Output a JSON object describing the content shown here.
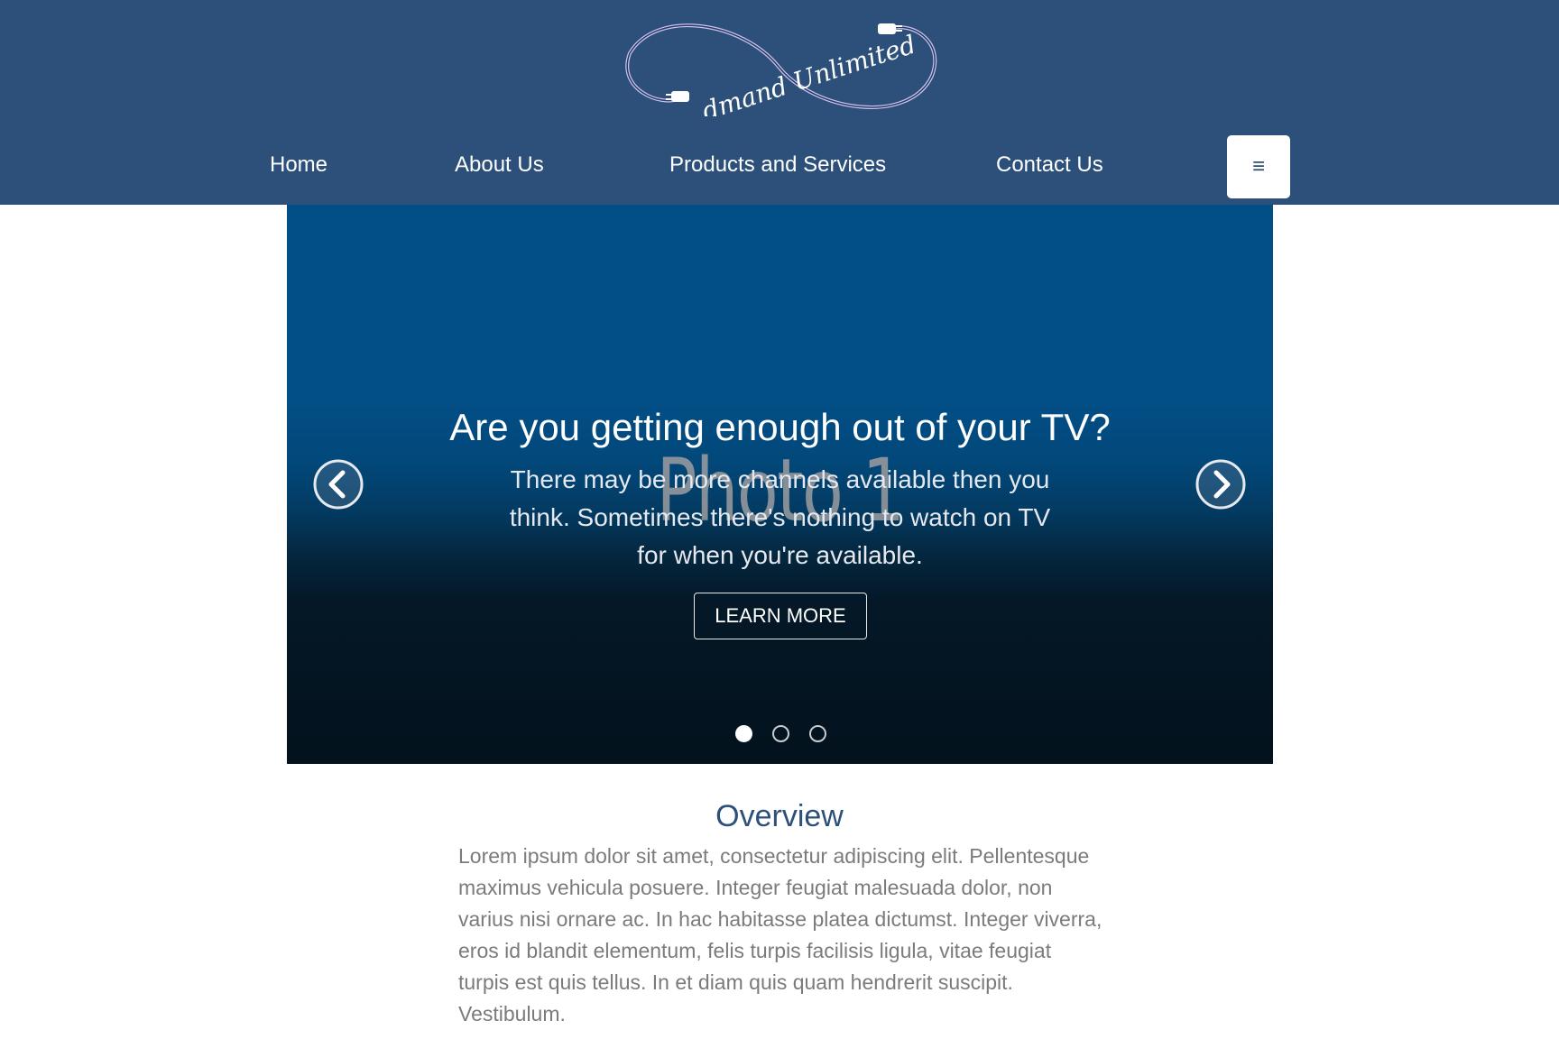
{
  "brand": {
    "logo_text": "dmand Unlimited",
    "colors": {
      "header_bg": "#2c5079",
      "hero_top": "#024f87",
      "hero_bottom": "#03121d",
      "heading": "#2c5079",
      "body_text": "#7b7b7b"
    }
  },
  "nav": {
    "items": [
      {
        "label": "Home"
      },
      {
        "label": "About Us"
      },
      {
        "label": "Products and Services"
      },
      {
        "label": "Contact Us"
      }
    ],
    "menu_icon": "hamburger-icon",
    "menu_glyph": "≡"
  },
  "hero": {
    "watermark": "Photo 1",
    "title": "Are you getting enough out of your TV?",
    "text": "There may be more channels available then you think. Sometimes there's nothing to watch on TV for when you're available.",
    "button_label": "LEARN MORE",
    "prev_icon": "chevron-left-icon",
    "next_icon": "chevron-right-icon",
    "slide_count": 3,
    "active_slide": 1
  },
  "overview": {
    "title": "Overview",
    "body": "Lorem ipsum dolor sit amet, consectetur adipiscing elit. Pellentesque maximus vehicula posuere. Integer feugiat malesuada dolor, non varius nisi ornare ac. In hac habitasse platea dictumst. Integer viverra, eros id blandit elementum, felis turpis facilisis ligula, vitae feugiat turpis est quis tellus. In et diam quis quam hendrerit suscipit. Vestibulum."
  }
}
